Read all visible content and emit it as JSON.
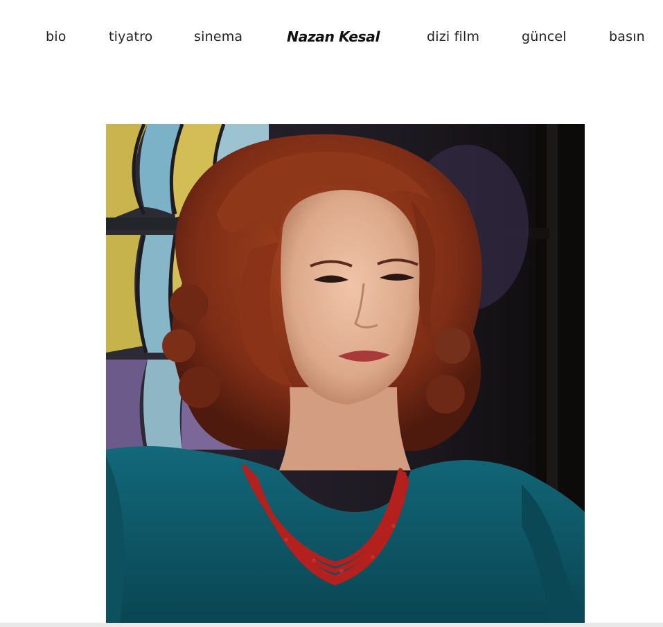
{
  "header": {
    "logo": "Nazan Kesal",
    "nav_left": [
      {
        "label": "bio"
      },
      {
        "label": "tiyatro"
      },
      {
        "label": "sinema"
      }
    ],
    "nav_right": [
      {
        "label": "dizi film"
      },
      {
        "label": "güncel"
      },
      {
        "label": "basın"
      }
    ]
  },
  "main": {
    "hero_photo": {
      "subject": "portrait-photo",
      "colors": {
        "hair": "#8a3218",
        "skin": "#e2ae91",
        "blouse": "#0f5866",
        "necklace": "#b3201e",
        "background_dark": "#1b1715",
        "stained_glass_yellow": "#c9b44d",
        "stained_glass_blue": "#7bb2c7"
      }
    }
  }
}
